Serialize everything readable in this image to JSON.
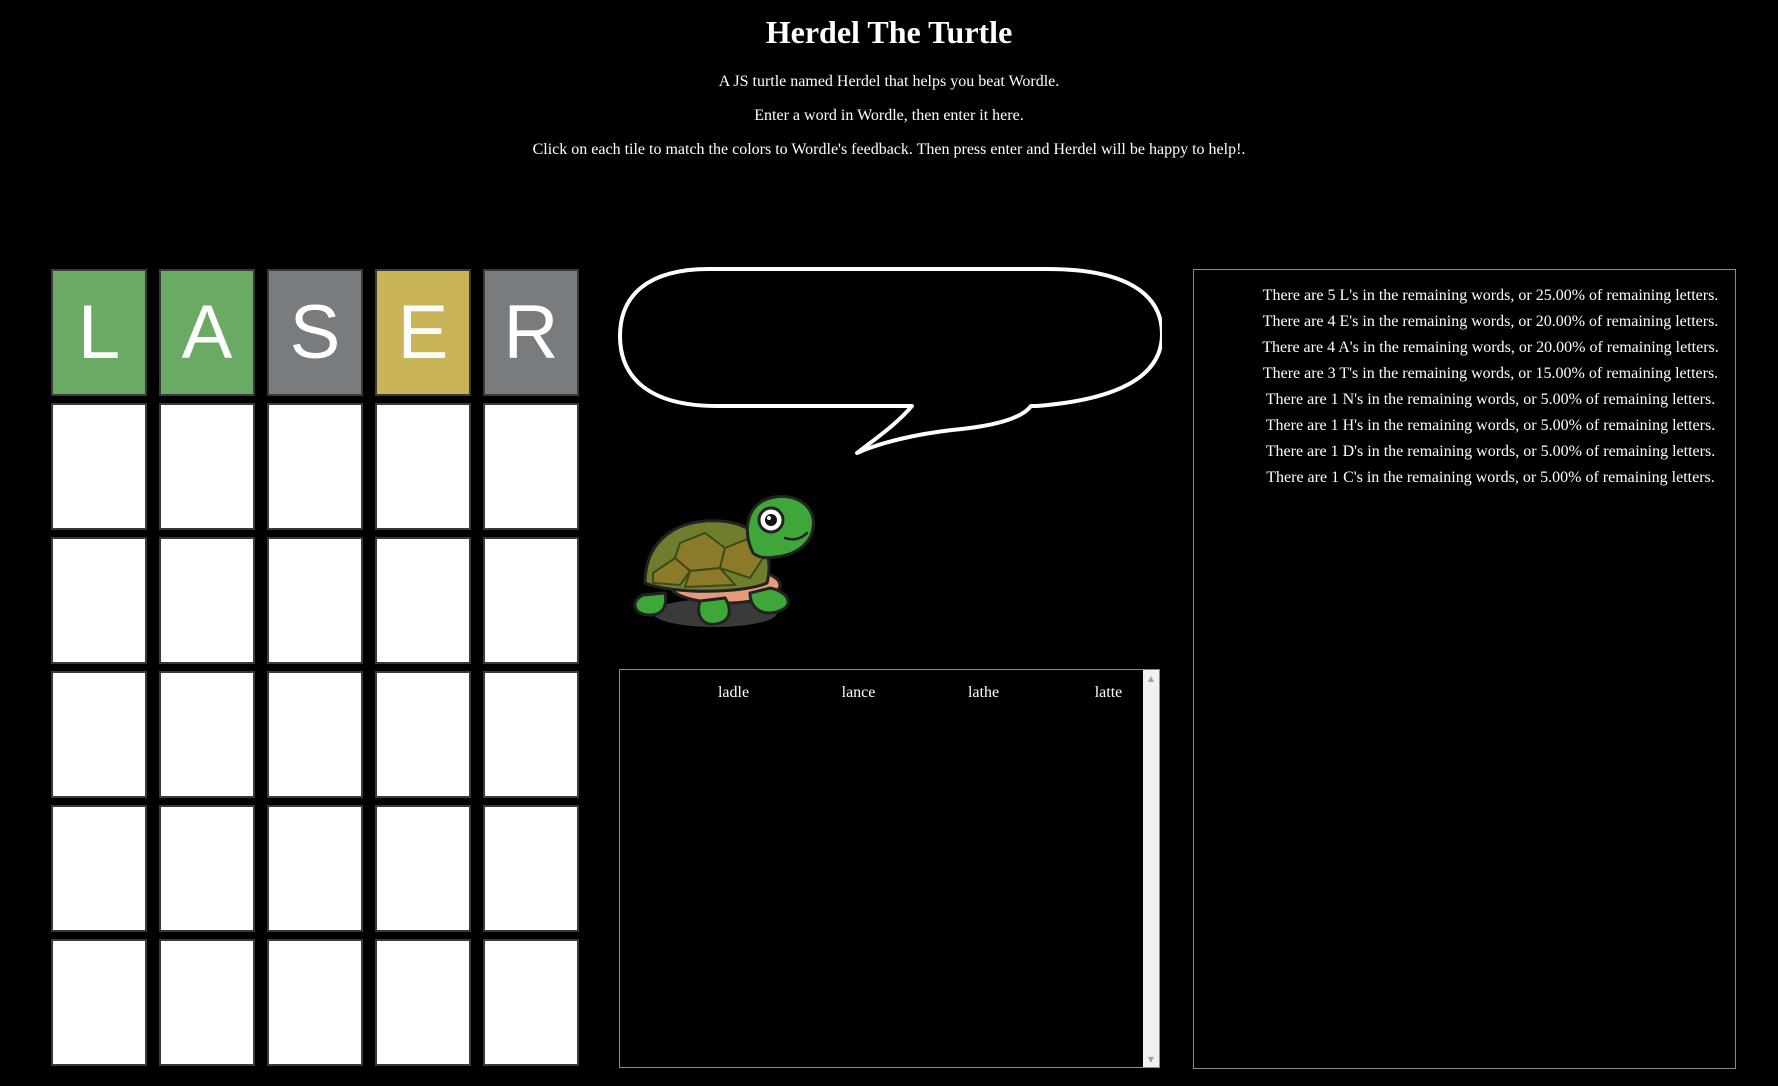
{
  "header": {
    "title": "Herdel The Turtle",
    "line1": "A JS turtle named Herdel that helps you beat Wordle.",
    "line2": "Enter a word in Wordle, then enter it here.",
    "line3": "Click on each tile to match the colors to Wordle's feedback. Then press enter and Herdel will be happy to help!."
  },
  "board": {
    "rows": [
      [
        {
          "letter": "L",
          "state": "green"
        },
        {
          "letter": "A",
          "state": "green"
        },
        {
          "letter": "S",
          "state": "gray"
        },
        {
          "letter": "E",
          "state": "yellow"
        },
        {
          "letter": "R",
          "state": "gray"
        }
      ],
      [
        {
          "letter": "",
          "state": "empty"
        },
        {
          "letter": "",
          "state": "empty"
        },
        {
          "letter": "",
          "state": "empty"
        },
        {
          "letter": "",
          "state": "empty"
        },
        {
          "letter": "",
          "state": "empty"
        }
      ],
      [
        {
          "letter": "",
          "state": "empty"
        },
        {
          "letter": "",
          "state": "empty"
        },
        {
          "letter": "",
          "state": "empty"
        },
        {
          "letter": "",
          "state": "empty"
        },
        {
          "letter": "",
          "state": "empty"
        }
      ],
      [
        {
          "letter": "",
          "state": "empty"
        },
        {
          "letter": "",
          "state": "empty"
        },
        {
          "letter": "",
          "state": "empty"
        },
        {
          "letter": "",
          "state": "empty"
        },
        {
          "letter": "",
          "state": "empty"
        }
      ],
      [
        {
          "letter": "",
          "state": "empty"
        },
        {
          "letter": "",
          "state": "empty"
        },
        {
          "letter": "",
          "state": "empty"
        },
        {
          "letter": "",
          "state": "empty"
        },
        {
          "letter": "",
          "state": "empty"
        }
      ],
      [
        {
          "letter": "",
          "state": "empty"
        },
        {
          "letter": "",
          "state": "empty"
        },
        {
          "letter": "",
          "state": "empty"
        },
        {
          "letter": "",
          "state": "empty"
        },
        {
          "letter": "",
          "state": "empty"
        }
      ]
    ]
  },
  "colors": {
    "green": "#6aaa64",
    "yellow": "#c9b458",
    "gray": "#787c7e",
    "empty": "#ffffff",
    "background": "#000000"
  },
  "speech_bubble": {
    "text": ""
  },
  "icons": {
    "turtle": "turtle-icon",
    "speech_bubble": "speech-bubble-icon",
    "scroll_up": "scroll-up-arrow-icon",
    "scroll_down": "scroll-down-arrow-icon"
  },
  "remaining_words": [
    "ladle",
    "lance",
    "lathe",
    "latte"
  ],
  "letter_stats": [
    "There are 5 L's in the remaining words, or 25.00% of remaining letters.",
    "There are 4 E's in the remaining words, or 20.00% of remaining letters.",
    "There are 4 A's in the remaining words, or 20.00% of remaining letters.",
    "There are 3 T's in the remaining words, or 15.00% of remaining letters.",
    "There are 1 N's in the remaining words, or 5.00% of remaining letters.",
    "There are 1 H's in the remaining words, or 5.00% of remaining letters.",
    "There are 1 D's in the remaining words, or 5.00% of remaining letters.",
    "There are 1 C's in the remaining words, or 5.00% of remaining letters."
  ]
}
